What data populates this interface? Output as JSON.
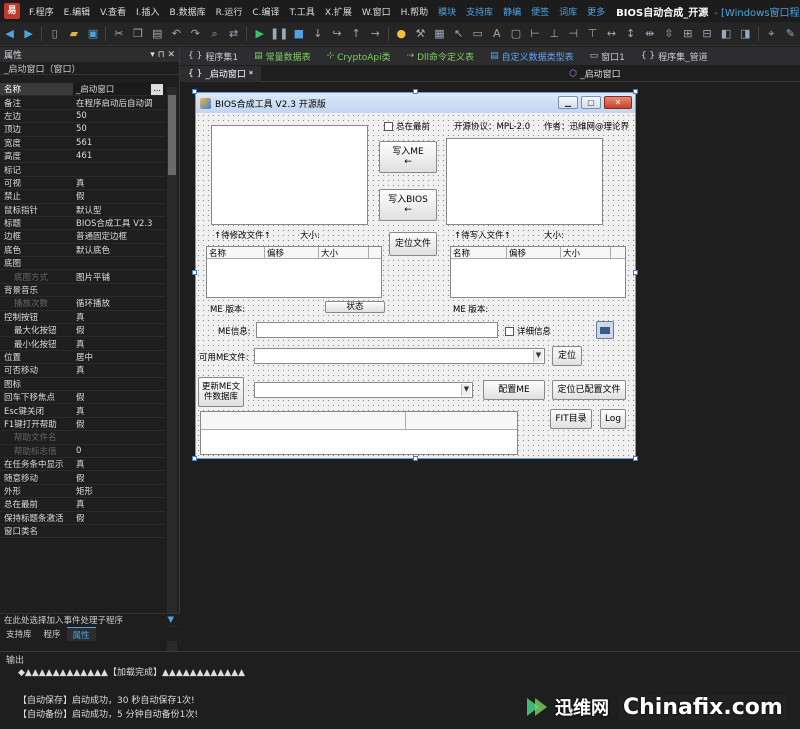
{
  "menubar": {
    "items": [
      "F.程序",
      "E.编辑",
      "V.查看",
      "I.插入",
      "B.数据库",
      "R.运行",
      "C.编译",
      "T.工具",
      "X.扩展",
      "W.窗口",
      "H.帮助"
    ],
    "links": [
      "模块",
      "支持库",
      "静编",
      "便签",
      "词库",
      "更多"
    ],
    "title": "BIOS自动合成_开源",
    "title_suffix": "- [Windows窗口程"
  },
  "tabs": [
    {
      "label": "程序集1",
      "prefix": "{ }"
    },
    {
      "label": "常量数据表",
      "prefix": "▤"
    },
    {
      "label": "CryptoApi类",
      "prefix": "⊹"
    },
    {
      "label": "Dll命令定义表",
      "prefix": "⇢"
    },
    {
      "label": "自定义数据类型表",
      "prefix": "▤"
    },
    {
      "label": "窗口1",
      "prefix": "▭"
    },
    {
      "label": "程序集_管道",
      "prefix": "{ }"
    }
  ],
  "subtabs": [
    {
      "label": "_启动窗口 *",
      "prefix": "{ }"
    },
    {
      "label": "_启动窗口",
      "prefix": "⬡"
    }
  ],
  "props": {
    "header": "属性",
    "selected": "_启动窗口（窗口）",
    "rows": [
      {
        "name": "名称",
        "value": "_启动窗口",
        "sel": true
      },
      {
        "name": "备注",
        "value": "在程序启动后自动调"
      },
      {
        "name": "左边",
        "value": "50"
      },
      {
        "name": "顶边",
        "value": "50"
      },
      {
        "name": "宽度",
        "value": "561"
      },
      {
        "name": "高度",
        "value": "461"
      },
      {
        "name": "标记",
        "value": ""
      },
      {
        "name": "可视",
        "value": "真"
      },
      {
        "name": "禁止",
        "value": "假"
      },
      {
        "name": "鼠标指针",
        "value": "默认型"
      },
      {
        "name": "标题",
        "value": "BIOS合成工具 V2.3"
      },
      {
        "name": "边框",
        "value": "普通固定边框"
      },
      {
        "name": "底色",
        "value": "默认底色"
      },
      {
        "name": "底图",
        "value": ""
      },
      {
        "name": "底图方式",
        "value": "图片平铺",
        "sub": true,
        "dim": true
      },
      {
        "name": "背景音乐",
        "value": ""
      },
      {
        "name": "播放次数",
        "value": "循环播放",
        "sub": true,
        "dim": true
      },
      {
        "name": "控制按钮",
        "value": "真"
      },
      {
        "name": "最大化按钮",
        "value": "假",
        "sub": true
      },
      {
        "name": "最小化按钮",
        "value": "真",
        "sub": true
      },
      {
        "name": "位置",
        "value": "居中"
      },
      {
        "name": "可否移动",
        "value": "真"
      },
      {
        "name": "图标",
        "value": ""
      },
      {
        "name": "回车下移焦点",
        "value": "假"
      },
      {
        "name": "Esc键关闭",
        "value": "真"
      },
      {
        "name": "F1键打开帮助",
        "value": "假"
      },
      {
        "name": "帮助文件名",
        "value": "",
        "sub": true,
        "dim": true
      },
      {
        "name": "帮助标志值",
        "value": "0",
        "sub": true,
        "dim": true
      },
      {
        "name": "在任务条中显示",
        "value": "真"
      },
      {
        "name": "随意移动",
        "value": "假"
      },
      {
        "name": "外形",
        "value": "矩形"
      },
      {
        "name": "总在最前",
        "value": "真"
      },
      {
        "name": "保持标题条激活",
        "value": "假"
      },
      {
        "name": "窗口类名",
        "value": ""
      }
    ],
    "hint": "在此处选择加入事件处理子程序",
    "bottom_tabs": [
      "支持库",
      "程序",
      "属性"
    ]
  },
  "form": {
    "title": "BIOS合成工具 V2.3 开源版",
    "always_on_top": "总在最前",
    "license": "开源协议：MPL-2.0",
    "author": "作者：迅维网@理论界",
    "write_me": [
      "写入ME",
      "←"
    ],
    "write_bios": [
      "写入BIOS",
      "←"
    ],
    "file_to_modify": "↑待修改文件↑",
    "size_label": "大小:",
    "locate_file": "定位文件",
    "file_to_write": "↑待写入文件↑",
    "size_label2": "大小:",
    "list_cols": [
      "名称",
      "偏移",
      "大小"
    ],
    "list_cols2": [
      "名称",
      "偏移",
      "大小"
    ],
    "me_version": "ME 版本:",
    "status_btn": "状态",
    "me_version2": "ME 版本:",
    "me_info": "ME信息:",
    "detail": "详细信息",
    "usable_me": "可用ME文件:",
    "locate_btn": "定位",
    "update_me": [
      "更新ME文",
      "件数据库"
    ],
    "config_me": "配置ME",
    "locate_config": "定位已配置文件",
    "fit_dir": "FIT目录",
    "log_btn": "Log"
  },
  "output": {
    "title": "输出",
    "lines": [
      "◆▲▲▲▲▲▲▲▲▲▲▲▲【加载完成】▲▲▲▲▲▲▲▲▲▲▲▲",
      "",
      "【自动保存】启动成功，30 秒自动保存1次!",
      "【自动备份】启动成功，5 分钟自动备份1次!"
    ]
  },
  "watermark": {
    "cn": "迅维网",
    "en": "Chinafix.com"
  }
}
